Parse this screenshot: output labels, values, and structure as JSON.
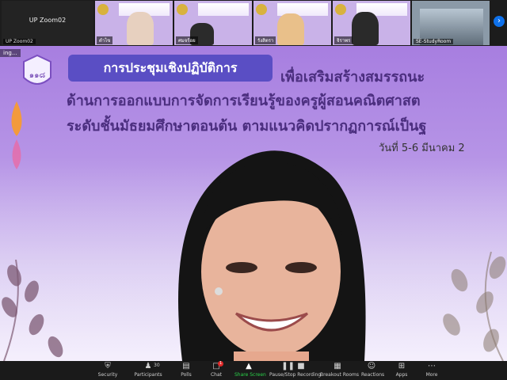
{
  "thumbnails": {
    "self_name": "UP Zoom02",
    "self_label": "UP Zoom02",
    "tiles": [
      {
        "name": "ดำไข"
      },
      {
        "name": "ศมจร้อย"
      },
      {
        "name": "รังสิตรา"
      },
      {
        "name": "จิราพร"
      },
      {
        "name": "SE-StudyRoom"
      }
    ],
    "next_icon": "chevron-right-icon"
  },
  "main": {
    "corner_label": "ing...",
    "logo_text": "๑๑๘",
    "title_box": "การประชุมเชิงปฏิบัติการ",
    "line1": "เพื่อเสริมสร้างสมรรถนะ",
    "line2": "ด้านการออกแบบการจัดการเรียนรู้ของครูผู้สอนคณิตศาสต",
    "line3": "ระดับชั้นมัธยมศึกษาตอนต้น ตามแนวคิดปรากฏการณ์เป็นฐ",
    "date": "วันที่ 5-6 มีนาคม 2"
  },
  "toolbar": {
    "security": "Security",
    "participants": "Participants",
    "participants_count": "30",
    "polls": "Polls",
    "chat": "Chat",
    "chat_badge": "1",
    "share": "Share Screen",
    "record": "Pause/Stop Recording",
    "breakout": "Breakout Rooms",
    "reactions": "Reactions",
    "apps": "Apps",
    "more": "More"
  },
  "colors": {
    "accent_green": "#2ad34a",
    "title_box": "#5a4ec4",
    "heading": "#4b2e7f",
    "zoom_blue": "#0e71eb"
  }
}
